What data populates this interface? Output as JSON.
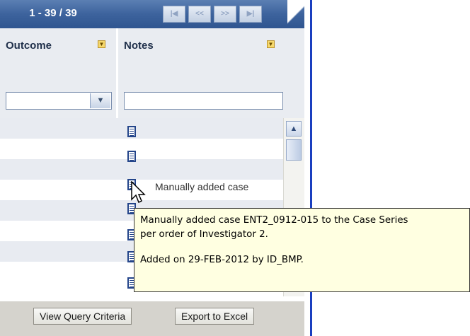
{
  "pager": {
    "range_label": "1 - 39 / 39",
    "buttons": [
      {
        "name": "first-page",
        "glyph": "|<<"
      },
      {
        "name": "previous-page",
        "glyph": "<<"
      },
      {
        "name": "next-page",
        "glyph": ">>"
      },
      {
        "name": "last-page",
        "glyph": ">>|"
      }
    ]
  },
  "columns": {
    "outcome": {
      "label": "Outcome",
      "filter_value": ""
    },
    "notes": {
      "label": "Notes",
      "filter_value": ""
    }
  },
  "rows": [
    {
      "note_icon": "note-icon",
      "note_text": ""
    },
    {
      "note_icon": "note-icon",
      "note_text": ""
    },
    {
      "note_icon": "note-icon",
      "note_text": "Manually added case"
    },
    {
      "note_icon": "note-icon",
      "note_text": ""
    },
    {
      "note_icon": "note-icon",
      "note_text": ""
    },
    {
      "note_icon": "note-icon",
      "note_text": ""
    },
    {
      "note_icon": "note-icon",
      "note_text": ""
    },
    {
      "note_icon": "note-icon",
      "note_text": ""
    }
  ],
  "tooltip": {
    "line1": "Manually added case ENT2_0912-015 to the Case Series",
    "line2": "per order of Investigator 2.",
    "line3": "Added on 29-FEB-2012 by ID_BMP."
  },
  "footer": {
    "view_query_label": "View Query Criteria",
    "export_label": "Export to Excel"
  },
  "colors": {
    "header_blue": "#3d639d",
    "row_alt": "#e8ebf1",
    "tooltip_bg": "#ffffe1",
    "separator_blue": "#1a3fbf"
  }
}
